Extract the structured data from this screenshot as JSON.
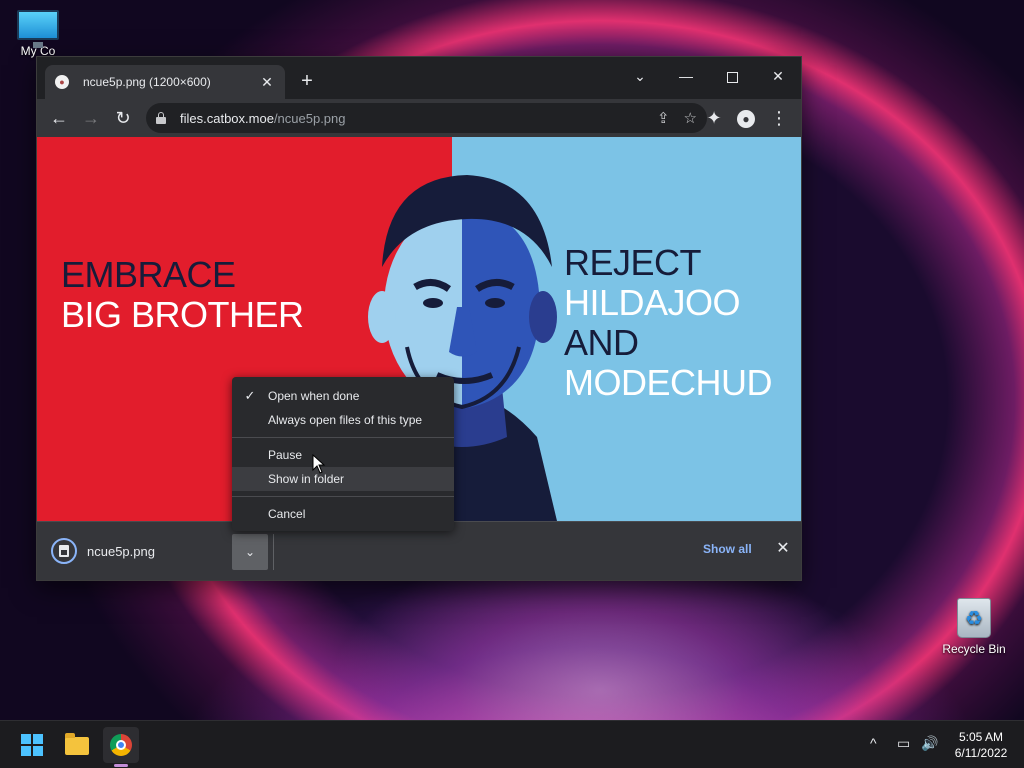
{
  "desktop": {
    "icons": [
      {
        "label": "My Co",
        "icon": "monitor-icon"
      },
      {
        "label": "Recycle Bin",
        "icon": "recycle-bin-icon"
      }
    ]
  },
  "browser": {
    "tab": {
      "title": "ncue5p.png (1200×600)",
      "close": "✕"
    },
    "new_tab": "+",
    "window_controls": {
      "search": "⌄",
      "minimize": "—",
      "close": "✕"
    },
    "toolbar": {
      "back": "←",
      "forward": "→",
      "reload": "↻",
      "extensions": "✦",
      "menu": "⋮",
      "share": "⇪",
      "bookmark": "☆",
      "profile": "●"
    },
    "url": {
      "host": "files.catbox.moe",
      "path": "/ncue5p.png"
    }
  },
  "image": {
    "left_lines": [
      "EMBRACE",
      "BIG BROTHER"
    ],
    "right_lines": [
      "REJECT",
      "HILDAJOO",
      "AND",
      "MODECHUD"
    ],
    "colors": {
      "red": "#e21d2c",
      "blue": "#7cc3e6",
      "navy": "#161c3a"
    }
  },
  "context_menu": {
    "items": [
      {
        "label": "Open when done",
        "checked": "✓"
      },
      {
        "label": "Always open files of this type"
      },
      {
        "label": "Pause"
      },
      {
        "label": "Show in folder"
      },
      {
        "label": "Cancel"
      }
    ]
  },
  "download_shelf": {
    "filename": "ncue5p.png",
    "dropdown": "⌄",
    "show_all": "Show all",
    "close": "✕"
  },
  "taskbar": {
    "tray": {
      "chevron": "^",
      "network": "▭",
      "volume": "🔊"
    },
    "clock": {
      "time": "5:05 AM",
      "date": "6/11/2022"
    }
  }
}
